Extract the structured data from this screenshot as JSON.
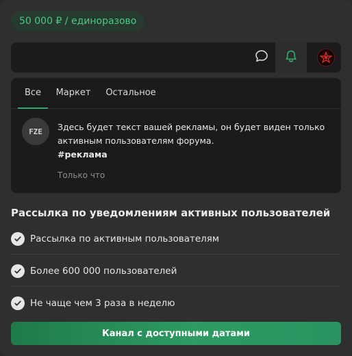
{
  "price_badge": "50 000 ₽ / единоразово",
  "topbar": {
    "icons": [
      "chat-bubble-icon",
      "bell-icon",
      "user-avatar"
    ],
    "accent_color": "#2fa86a"
  },
  "tabs": [
    {
      "label": "Все",
      "active": true
    },
    {
      "label": "Маркет",
      "active": false
    },
    {
      "label": "Остальное",
      "active": false
    }
  ],
  "notification": {
    "avatar_text": "FZE",
    "text": "Здесь будет текст вашей рекламы, он будет виден только активным пользователям форума.",
    "tag": "#реклама",
    "time": "Только что"
  },
  "section_title": "Рассылка по уведомлениям активных пользователей",
  "features": [
    "Рассылка по активным пользователям",
    "Более 600 000 пользователей",
    "Не чаще чем 3 раза в неделю"
  ],
  "cta_label": "Канал с доступными датами"
}
